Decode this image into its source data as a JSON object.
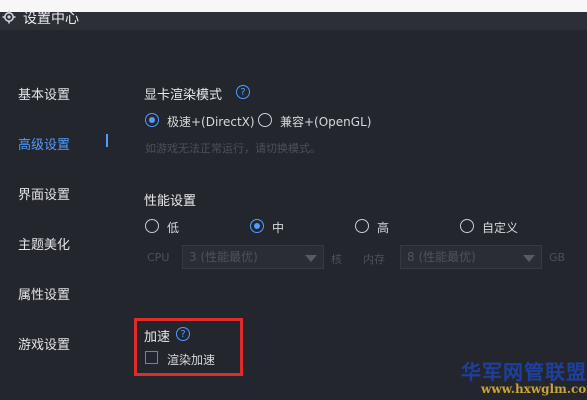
{
  "window": {
    "title": "设置中心",
    "icon": "gear-icon"
  },
  "sidebar": {
    "items": [
      {
        "label": "基本设置",
        "active": false
      },
      {
        "label": "高级设置",
        "active": true
      },
      {
        "label": "界面设置",
        "active": false
      },
      {
        "label": "主题美化",
        "active": false
      },
      {
        "label": "属性设置",
        "active": false
      },
      {
        "label": "游戏设置",
        "active": false
      }
    ]
  },
  "graphics": {
    "title": "显卡渲染模式",
    "help_icon": "question-icon",
    "options": [
      {
        "label": "极速+(DirectX)",
        "checked": true
      },
      {
        "label": "兼容+(OpenGL)",
        "checked": false
      }
    ],
    "hint": "如游戏无法正常运行，请切换模式。"
  },
  "performance": {
    "title": "性能设置",
    "options": [
      {
        "label": "低",
        "checked": false
      },
      {
        "label": "中",
        "checked": true
      },
      {
        "label": "高",
        "checked": false
      },
      {
        "label": "自定义",
        "checked": false
      }
    ],
    "cpu_label": "CPU",
    "cpu_value": "3 (性能最优)",
    "cpu_unit": "核",
    "mem_label": "内存",
    "mem_value": "8 (性能最优)",
    "mem_unit": "GB"
  },
  "acceleration": {
    "title": "加速",
    "help_icon": "question-icon",
    "option_label": "渲染加速",
    "checked": false
  },
  "watermark": {
    "main": "华军网管联盟",
    "url": "www.hxwglm.com"
  },
  "colors": {
    "accent": "#4f9cff",
    "background": "#24262d",
    "highlight_box": "#e02b2b"
  }
}
